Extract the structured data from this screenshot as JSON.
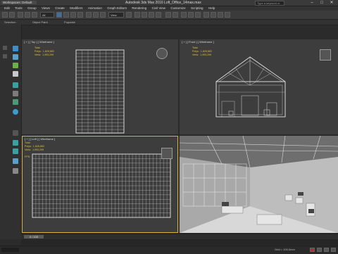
{
  "window": {
    "workspace": "Workspaces: Default",
    "title": "Autodesk 3ds Max 2016    Loft_Office_14max.max",
    "search_placeholder": "Type a keyword or phrase",
    "minimize": "–",
    "maximize": "□",
    "close": "✕"
  },
  "menu": [
    "Edit",
    "Tools",
    "Group",
    "Views",
    "Create",
    "Modifiers",
    "Animation",
    "Graph Editors",
    "Rendering",
    "Civil View",
    "Customize",
    "Scripting",
    "Help"
  ],
  "toolbar": {
    "filter_dropdown": "All",
    "view_dropdown": "View"
  },
  "ribbon": [
    "Selection",
    "Object Paint",
    "Populate"
  ],
  "viewports": {
    "top": {
      "label": "[ + ] [ Top ] [ Wireframe ]",
      "stats": "Total\nPolys:  1,828,883\nVerts:  1,993,299"
    },
    "front": {
      "label": "[ + ] [ Front ] [ Wireframe ]",
      "stats": "Total\nPolys:  1,828,883\nVerts:  1,993,299"
    },
    "left": {
      "label": "[ + ] [ Left ] [ Wireframe ]",
      "stats": "Total\nPolys:  1,828,883\nVerts:  1,993,299\n\nFPS:"
    },
    "perspective": {
      "label": ""
    }
  },
  "timeline": {
    "frame": "0 / 100"
  },
  "status": {
    "grid": "Grid = 100,0mm"
  },
  "colors": {
    "accent": "#d8b23a",
    "key_red": "#b32c2c"
  }
}
